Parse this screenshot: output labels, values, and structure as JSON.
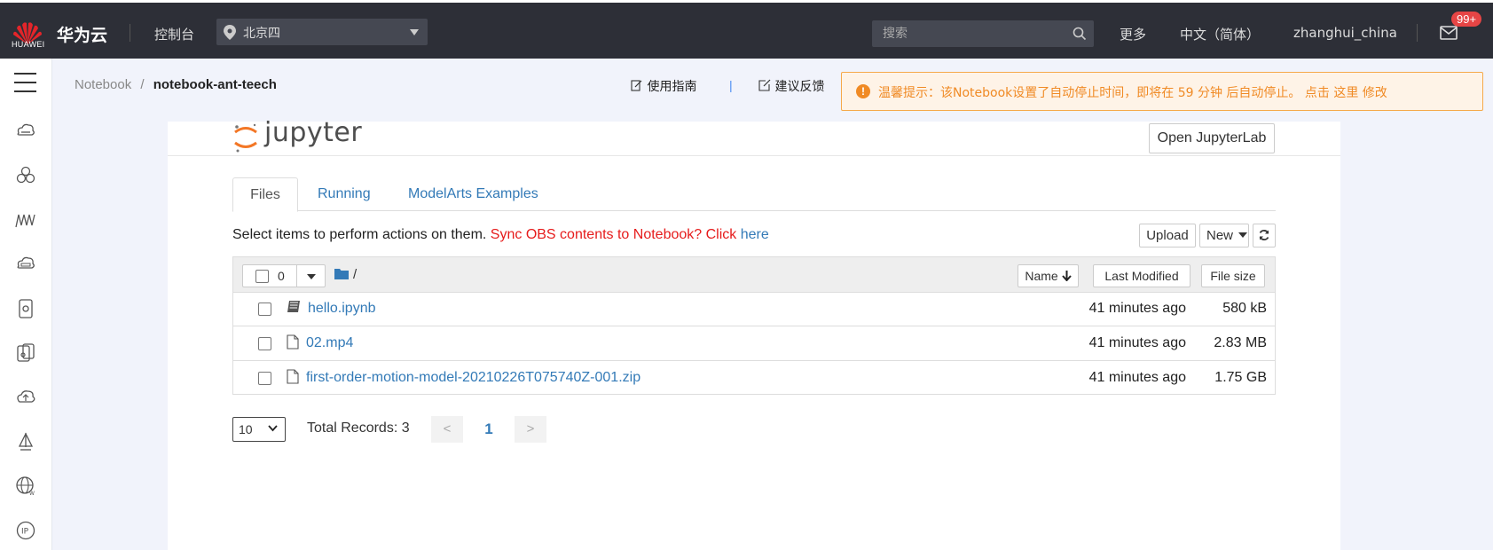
{
  "topbar": {
    "logo_text": "HUAWEI",
    "brand": "华为云",
    "console": "控制台",
    "region": "北京四",
    "search_placeholder": "搜索",
    "more": "更多",
    "language": "中文（简体）",
    "username": "zhanghui_china",
    "mail_badge": "99+"
  },
  "sidebar": {
    "icons": [
      "cloud-server-icon",
      "cluster-icon",
      "waveform-icon",
      "cloud-disk-icon",
      "container-icon",
      "devices-icon",
      "cloud-upload-icon",
      "sail-icon",
      "globe-icon",
      "ip-icon"
    ]
  },
  "breadcrumb": {
    "root": "Notebook",
    "separator": "/",
    "current": "notebook-ant-teech"
  },
  "toplinks": {
    "guide": "使用指南",
    "divider": "|",
    "feedback": "建议反馈"
  },
  "notice": {
    "icon": "!",
    "text": "温馨提示：该Notebook设置了自动停止时间，即将在 59 分钟 后自动停止。 点击 这里 修改"
  },
  "jupyter": {
    "logo_text": "jupyter",
    "open_lab": "Open JupyterLab",
    "tabs": [
      {
        "label": "Files"
      },
      {
        "label": "Running"
      },
      {
        "label": "ModelArts Examples"
      }
    ],
    "select_msg": "Select items to perform actions on them.",
    "sync_msg": "Sync OBS contents to Notebook? Click",
    "here": "here",
    "upload": "Upload",
    "new": "New",
    "selected_count": "0",
    "path": "/",
    "headers": {
      "name": "Name",
      "modified": "Last Modified",
      "size": "File size"
    },
    "files": [
      {
        "name": "hello.ipynb",
        "modified": "41 minutes ago",
        "size": "580 kB",
        "icon": "notebook-icon"
      },
      {
        "name": "02.mp4",
        "modified": "41 minutes ago",
        "size": "2.83 MB",
        "icon": "file-icon"
      },
      {
        "name": "first-order-motion-model-20210226T075740Z-001.zip",
        "modified": "41 minutes ago",
        "size": "1.75 GB",
        "icon": "file-icon"
      }
    ],
    "page_size": "10",
    "total_label": "Total Records: 3",
    "prev": "<",
    "current_page": "1",
    "next": ">"
  },
  "colors": {
    "topbar_bg": "#2d2f37",
    "content_bg": "#f1f3fb",
    "link": "#337ab7",
    "notice_orange": "#f08a24",
    "sync_red": "#e61b1b"
  }
}
